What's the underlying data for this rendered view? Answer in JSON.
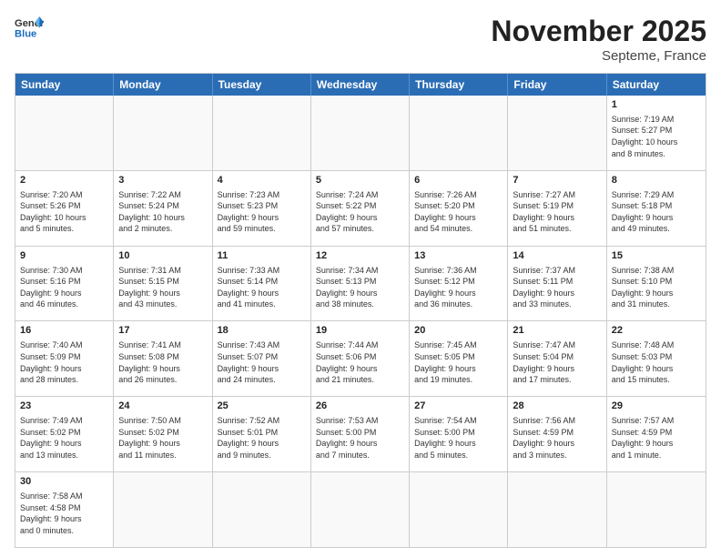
{
  "header": {
    "logo_general": "General",
    "logo_blue": "Blue",
    "month": "November 2025",
    "location": "Septeme, France"
  },
  "days_of_week": [
    "Sunday",
    "Monday",
    "Tuesday",
    "Wednesday",
    "Thursday",
    "Friday",
    "Saturday"
  ],
  "rows": [
    [
      {
        "day": "",
        "text": ""
      },
      {
        "day": "",
        "text": ""
      },
      {
        "day": "",
        "text": ""
      },
      {
        "day": "",
        "text": ""
      },
      {
        "day": "",
        "text": ""
      },
      {
        "day": "",
        "text": ""
      },
      {
        "day": "1",
        "text": "Sunrise: 7:19 AM\nSunset: 5:27 PM\nDaylight: 10 hours\nand 8 minutes."
      }
    ],
    [
      {
        "day": "2",
        "text": "Sunrise: 7:20 AM\nSunset: 5:26 PM\nDaylight: 10 hours\nand 5 minutes."
      },
      {
        "day": "3",
        "text": "Sunrise: 7:22 AM\nSunset: 5:24 PM\nDaylight: 10 hours\nand 2 minutes."
      },
      {
        "day": "4",
        "text": "Sunrise: 7:23 AM\nSunset: 5:23 PM\nDaylight: 9 hours\nand 59 minutes."
      },
      {
        "day": "5",
        "text": "Sunrise: 7:24 AM\nSunset: 5:22 PM\nDaylight: 9 hours\nand 57 minutes."
      },
      {
        "day": "6",
        "text": "Sunrise: 7:26 AM\nSunset: 5:20 PM\nDaylight: 9 hours\nand 54 minutes."
      },
      {
        "day": "7",
        "text": "Sunrise: 7:27 AM\nSunset: 5:19 PM\nDaylight: 9 hours\nand 51 minutes."
      },
      {
        "day": "8",
        "text": "Sunrise: 7:29 AM\nSunset: 5:18 PM\nDaylight: 9 hours\nand 49 minutes."
      }
    ],
    [
      {
        "day": "9",
        "text": "Sunrise: 7:30 AM\nSunset: 5:16 PM\nDaylight: 9 hours\nand 46 minutes."
      },
      {
        "day": "10",
        "text": "Sunrise: 7:31 AM\nSunset: 5:15 PM\nDaylight: 9 hours\nand 43 minutes."
      },
      {
        "day": "11",
        "text": "Sunrise: 7:33 AM\nSunset: 5:14 PM\nDaylight: 9 hours\nand 41 minutes."
      },
      {
        "day": "12",
        "text": "Sunrise: 7:34 AM\nSunset: 5:13 PM\nDaylight: 9 hours\nand 38 minutes."
      },
      {
        "day": "13",
        "text": "Sunrise: 7:36 AM\nSunset: 5:12 PM\nDaylight: 9 hours\nand 36 minutes."
      },
      {
        "day": "14",
        "text": "Sunrise: 7:37 AM\nSunset: 5:11 PM\nDaylight: 9 hours\nand 33 minutes."
      },
      {
        "day": "15",
        "text": "Sunrise: 7:38 AM\nSunset: 5:10 PM\nDaylight: 9 hours\nand 31 minutes."
      }
    ],
    [
      {
        "day": "16",
        "text": "Sunrise: 7:40 AM\nSunset: 5:09 PM\nDaylight: 9 hours\nand 28 minutes."
      },
      {
        "day": "17",
        "text": "Sunrise: 7:41 AM\nSunset: 5:08 PM\nDaylight: 9 hours\nand 26 minutes."
      },
      {
        "day": "18",
        "text": "Sunrise: 7:43 AM\nSunset: 5:07 PM\nDaylight: 9 hours\nand 24 minutes."
      },
      {
        "day": "19",
        "text": "Sunrise: 7:44 AM\nSunset: 5:06 PM\nDaylight: 9 hours\nand 21 minutes."
      },
      {
        "day": "20",
        "text": "Sunrise: 7:45 AM\nSunset: 5:05 PM\nDaylight: 9 hours\nand 19 minutes."
      },
      {
        "day": "21",
        "text": "Sunrise: 7:47 AM\nSunset: 5:04 PM\nDaylight: 9 hours\nand 17 minutes."
      },
      {
        "day": "22",
        "text": "Sunrise: 7:48 AM\nSunset: 5:03 PM\nDaylight: 9 hours\nand 15 minutes."
      }
    ],
    [
      {
        "day": "23",
        "text": "Sunrise: 7:49 AM\nSunset: 5:02 PM\nDaylight: 9 hours\nand 13 minutes."
      },
      {
        "day": "24",
        "text": "Sunrise: 7:50 AM\nSunset: 5:02 PM\nDaylight: 9 hours\nand 11 minutes."
      },
      {
        "day": "25",
        "text": "Sunrise: 7:52 AM\nSunset: 5:01 PM\nDaylight: 9 hours\nand 9 minutes."
      },
      {
        "day": "26",
        "text": "Sunrise: 7:53 AM\nSunset: 5:00 PM\nDaylight: 9 hours\nand 7 minutes."
      },
      {
        "day": "27",
        "text": "Sunrise: 7:54 AM\nSunset: 5:00 PM\nDaylight: 9 hours\nand 5 minutes."
      },
      {
        "day": "28",
        "text": "Sunrise: 7:56 AM\nSunset: 4:59 PM\nDaylight: 9 hours\nand 3 minutes."
      },
      {
        "day": "29",
        "text": "Sunrise: 7:57 AM\nSunset: 4:59 PM\nDaylight: 9 hours\nand 1 minute."
      }
    ],
    [
      {
        "day": "30",
        "text": "Sunrise: 7:58 AM\nSunset: 4:58 PM\nDaylight: 9 hours\nand 0 minutes."
      },
      {
        "day": "",
        "text": ""
      },
      {
        "day": "",
        "text": ""
      },
      {
        "day": "",
        "text": ""
      },
      {
        "day": "",
        "text": ""
      },
      {
        "day": "",
        "text": ""
      },
      {
        "day": "",
        "text": ""
      }
    ]
  ]
}
